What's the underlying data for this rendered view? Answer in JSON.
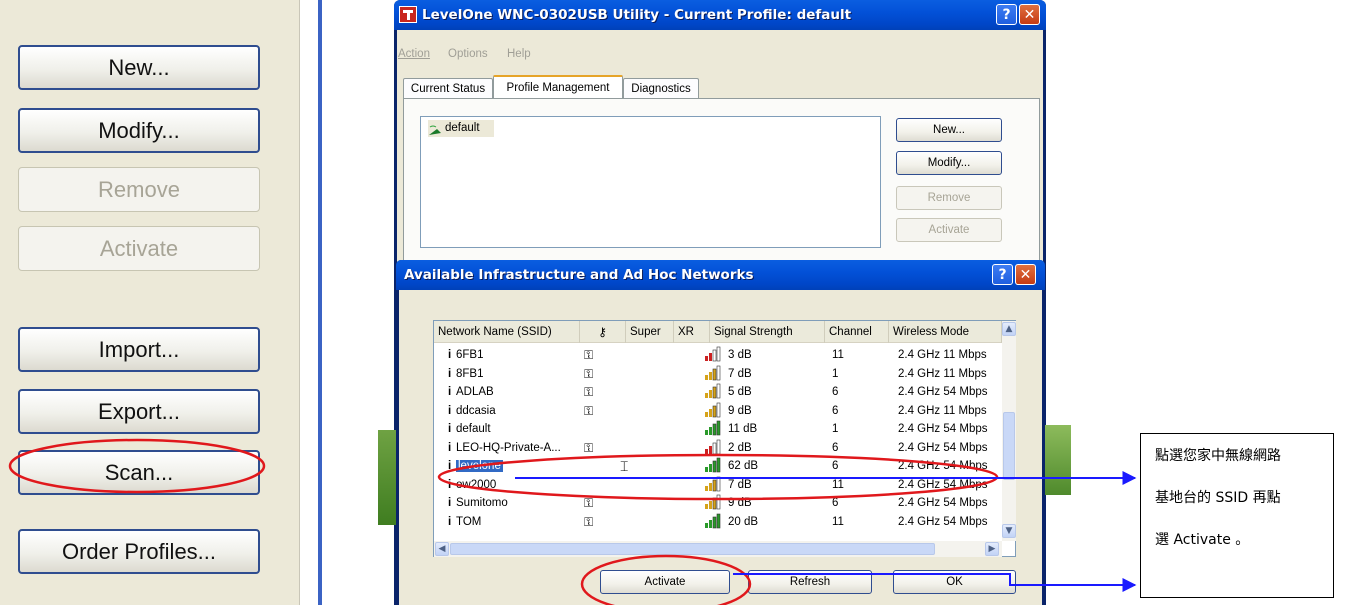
{
  "left_panel": {
    "buttons": [
      {
        "label": "New...",
        "enabled": true
      },
      {
        "label": "Modify...",
        "enabled": true
      },
      {
        "label": "Remove",
        "enabled": false
      },
      {
        "label": "Activate",
        "enabled": false
      },
      {
        "label": "Import...",
        "enabled": true
      },
      {
        "label": "Export...",
        "enabled": true
      },
      {
        "label": "Scan...",
        "enabled": true
      },
      {
        "label": "Order Profiles...",
        "enabled": true
      }
    ]
  },
  "main_window": {
    "title": "LevelOne WNC-0302USB Utility - Current Profile: default",
    "menu": [
      "Action",
      "Options",
      "Help"
    ],
    "tabs": [
      "Current Status",
      "Profile Management",
      "Diagnostics"
    ],
    "active_tab": "Profile Management",
    "profiles": [
      "default"
    ],
    "buttons": {
      "new": "New...",
      "modify": "Modify...",
      "remove": "Remove",
      "activate": "Activate"
    }
  },
  "dialog": {
    "title": "Available Infrastructure and Ad Hoc Networks",
    "columns": [
      "Network Name (SSID)",
      "",
      "Super",
      "XR",
      "Signal Strength",
      "Channel",
      "Wireless Mode"
    ],
    "networks": [
      {
        "ssid": "6FB1",
        "encrypted": true,
        "signal": "3 dB",
        "channel": "11",
        "mode": "2.4 GHz 11 Mbps"
      },
      {
        "ssid": "8FB1",
        "encrypted": true,
        "signal": "7 dB",
        "channel": "1",
        "mode": "2.4 GHz 11 Mbps"
      },
      {
        "ssid": "ADLAB",
        "encrypted": true,
        "signal": "5 dB",
        "channel": "6",
        "mode": "2.4 GHz 54 Mbps"
      },
      {
        "ssid": "ddcasia",
        "encrypted": true,
        "signal": "9 dB",
        "channel": "6",
        "mode": "2.4 GHz 11 Mbps"
      },
      {
        "ssid": "default",
        "encrypted": false,
        "signal": "11 dB",
        "channel": "1",
        "mode": "2.4 GHz 54 Mbps"
      },
      {
        "ssid": "LEO-HQ-Private-A...",
        "encrypted": true,
        "signal": "2 dB",
        "channel": "6",
        "mode": "2.4 GHz 54 Mbps"
      },
      {
        "ssid": "levelone",
        "encrypted": false,
        "signal": "62 dB",
        "channel": "6",
        "mode": "2.4 GHz 54 Mbps",
        "selected": true
      },
      {
        "ssid": "ow2000",
        "encrypted": false,
        "signal": "7 dB",
        "channel": "11",
        "mode": "2.4 GHz 54 Mbps"
      },
      {
        "ssid": "Sumitomo",
        "encrypted": true,
        "signal": "9 dB",
        "channel": "6",
        "mode": "2.4 GHz 54 Mbps"
      },
      {
        "ssid": "TOM",
        "encrypted": true,
        "signal": "20 dB",
        "channel": "11",
        "mode": "2.4 GHz 54 Mbps"
      }
    ],
    "buttons": {
      "activate": "Activate",
      "refresh": "Refresh",
      "ok": "OK"
    }
  },
  "annotation": {
    "lines": [
      "點選您家中無線網路",
      "基地台的 SSID 再點",
      "選 Activate 。"
    ]
  },
  "colors": {
    "highlight_ring": "#e0181c",
    "arrow": "#1a1aff",
    "selection": "#316ac5",
    "xp_title": "#0050d8"
  }
}
